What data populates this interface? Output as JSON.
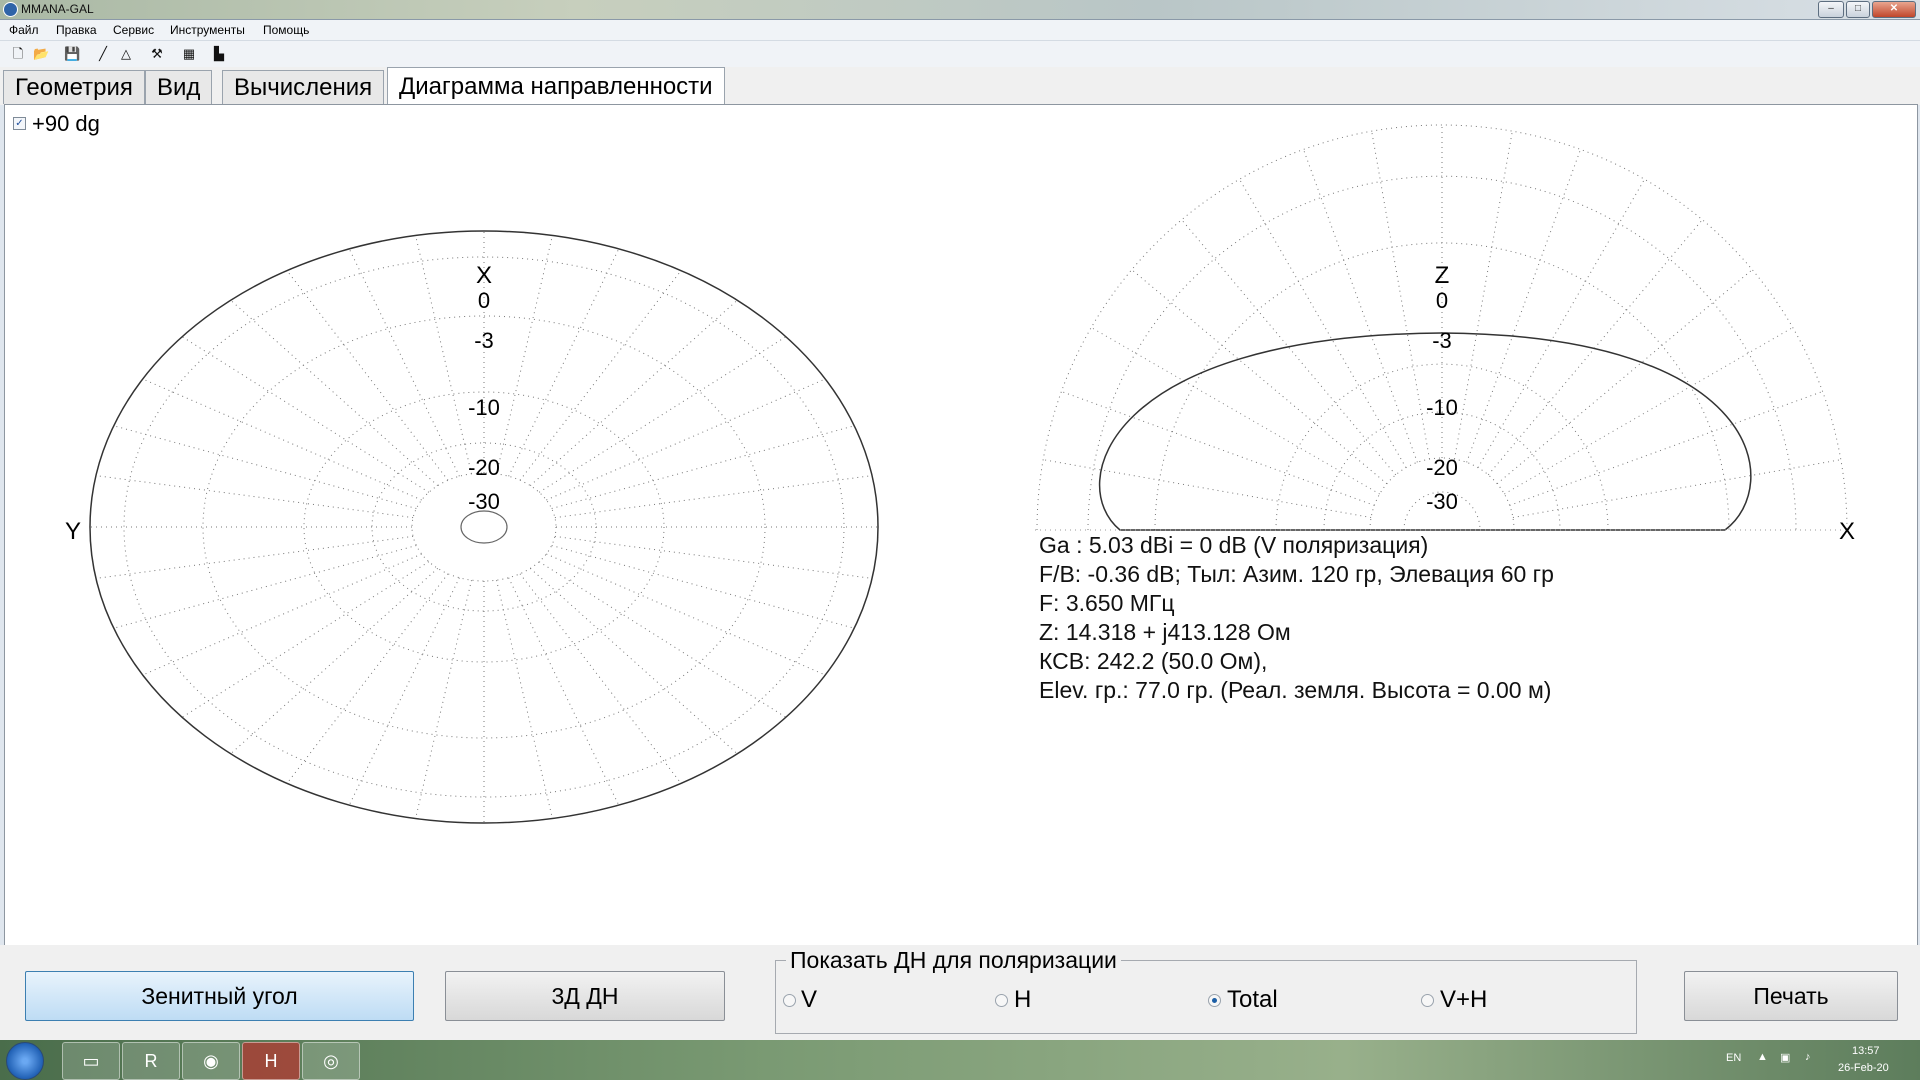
{
  "window": {
    "title": "MMANA-GAL",
    "minimize": "–",
    "maximize": "□",
    "close": "✕"
  },
  "menu": [
    "Файл",
    "Правка",
    "Сервис",
    "Инструменты",
    "Помощь"
  ],
  "toolbar_icons": [
    "new-file-icon",
    "open-folder-icon",
    "save-icon",
    "line-tool-icon",
    "triangle-tool-icon",
    "tools-icon",
    "calculator-icon",
    "report-icon"
  ],
  "tabs": [
    {
      "label": "Геометрия",
      "active": false
    },
    {
      "label": "Вид",
      "active": false
    },
    {
      "label": "Вычисления",
      "active": false
    },
    {
      "label": "Диаграмма направленности",
      "active": true
    }
  ],
  "panel": {
    "checkbox_label": "+90 dg",
    "checkbox_checked": true
  },
  "plots": {
    "azimuth": {
      "axis_top": "X",
      "axis_left": "Y",
      "ring_labels": [
        "0",
        "-3",
        "-10",
        "-20",
        "-30"
      ]
    },
    "elevation": {
      "axis_top": "Z",
      "axis_right": "X",
      "ring_labels": [
        "0",
        "-3",
        "-10",
        "-20",
        "-30"
      ]
    }
  },
  "info": {
    "lines": [
      "Ga : 5.03 dBi = 0 dB  (V поляризация)",
      "F/B: -0.36 dB; Тыл: Азим. 120 гр, Элевация 60 гр",
      "F: 3.650 МГц",
      "Z: 14.318 + j413.128 Ом",
      "КСВ: 242.2 (50.0 Ом),",
      "Elev. гр.: 77.0 гр. (Реал. земля. Высота = 0.00 м)"
    ]
  },
  "bottom": {
    "zenith_button": "Зенитный угол",
    "threed_button": "3Д   ДН",
    "polarization_title": "Показать ДН для поляризации",
    "radios": [
      {
        "label": "V",
        "selected": false
      },
      {
        "label": "H",
        "selected": false
      },
      {
        "label": "Total",
        "selected": true
      },
      {
        "label": "V+H",
        "selected": false
      }
    ],
    "print_button": "Печать"
  },
  "taskbar": {
    "apps": [
      "explorer",
      "RF",
      "chrome",
      "HY",
      "MMANA"
    ],
    "lang": "EN",
    "time": "13:57",
    "date": "26-Feb-20"
  }
}
